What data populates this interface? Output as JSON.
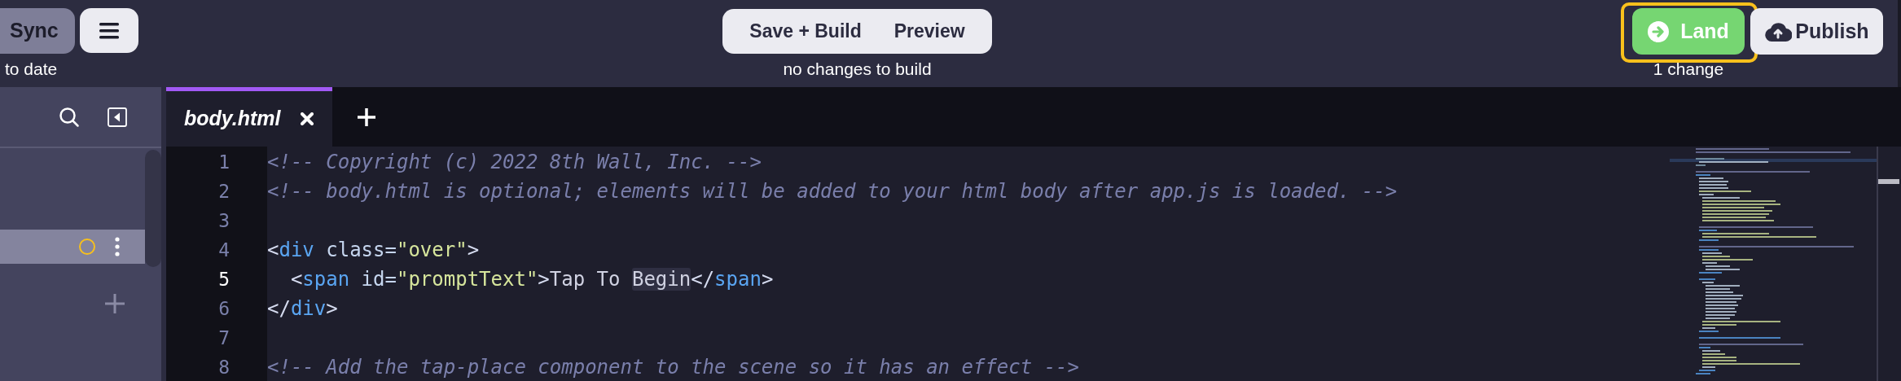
{
  "toolbar": {
    "sync": {
      "label": "Sync",
      "status": "to date"
    },
    "build": {
      "buttons": [
        "Save + Build",
        "Preview"
      ],
      "status": "no changes to build"
    },
    "land": {
      "label": "Land",
      "highlighted": true,
      "status": "1 change"
    },
    "publish": {
      "label": "Publish"
    }
  },
  "sidebar": {
    "file_row": {
      "selected": true,
      "modified": true
    }
  },
  "tabs": [
    {
      "label": "body.html",
      "selected": true
    }
  ],
  "editor": {
    "lines": [
      {
        "number": "1",
        "current": false,
        "tokens": [
          {
            "kind": "comment",
            "text": "<!-- Copyright (c) 2022 8th Wall, Inc. -->"
          }
        ]
      },
      {
        "number": "2",
        "current": false,
        "tokens": [
          {
            "kind": "comment",
            "text": "<!-- body.html is optional; elements will be added to your html body after app.js is loaded. -->"
          }
        ]
      },
      {
        "number": "3",
        "current": false
      },
      {
        "number": "4",
        "current": false,
        "tokens": [
          {
            "kind": "punct",
            "text": "<"
          },
          {
            "kind": "tag",
            "text": "div"
          },
          {
            "kind": "attr",
            "text": " class="
          },
          {
            "kind": "string",
            "text": "\"over\""
          },
          {
            "kind": "punct",
            "text": ">"
          }
        ]
      },
      {
        "number": "5",
        "current": true,
        "tokens": [
          {
            "kind": "punct",
            "text": "  <"
          },
          {
            "kind": "tag",
            "text": "span"
          },
          {
            "kind": "attr",
            "text": " id="
          },
          {
            "kind": "string",
            "text": "\"promptText\""
          },
          {
            "kind": "punct",
            "text": ">"
          },
          {
            "kind": "text",
            "text": "Tap To "
          },
          {
            "kind": "match",
            "text": "Begin"
          },
          {
            "kind": "punct",
            "text": "</"
          },
          {
            "kind": "tag",
            "text": "span"
          },
          {
            "kind": "punct",
            "text": ">"
          }
        ]
      },
      {
        "number": "6",
        "current": false,
        "tokens": [
          {
            "kind": "punct",
            "text": "</"
          },
          {
            "kind": "tag",
            "text": "div"
          },
          {
            "kind": "punct",
            "text": ">"
          }
        ]
      },
      {
        "number": "7",
        "current": false
      },
      {
        "number": "8",
        "current": false,
        "tokens": [
          {
            "kind": "comment",
            "text": "<!-- Add the tap-place component to the scene so it has an effect -->"
          }
        ]
      }
    ]
  }
}
